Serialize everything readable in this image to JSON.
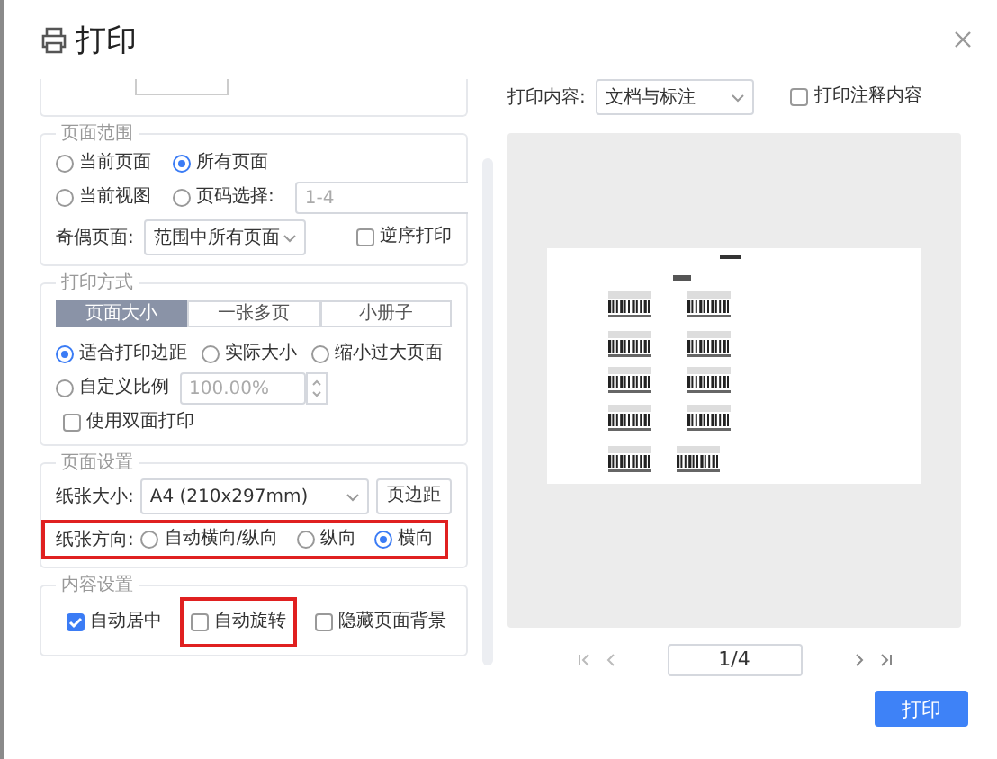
{
  "dialog": {
    "title": "打印"
  },
  "page_range": {
    "title": "页面范围",
    "options": [
      {
        "label": "当前页面",
        "selected": false
      },
      {
        "label": "所有页面",
        "selected": true
      },
      {
        "label": "当前视图",
        "selected": false
      },
      {
        "label": "页码选择:",
        "selected": false
      }
    ],
    "page_input": {
      "placeholder": "1-4"
    },
    "odd_even": {
      "label": "奇偶页面:",
      "value": "范围中所有页面"
    },
    "reverse": {
      "label": "逆序打印",
      "checked": false
    }
  },
  "print_mode": {
    "title": "打印方式",
    "tabs": [
      {
        "label": "页面大小",
        "selected": true
      },
      {
        "label": "一张多页",
        "selected": false
      },
      {
        "label": "小册子",
        "selected": false
      }
    ],
    "scale_options": [
      {
        "label": "适合打印边距",
        "selected": true
      },
      {
        "label": "实际大小",
        "selected": false
      },
      {
        "label": "缩小过大页面",
        "selected": false
      },
      {
        "label": "自定义比例",
        "selected": false
      }
    ],
    "scale_input": {
      "placeholder": "100.00%"
    },
    "duplex": {
      "label": "使用双面打印",
      "checked": false
    }
  },
  "page_setup": {
    "title": "页面设置",
    "paper_label": "纸张大小:",
    "paper_value": "A4 (210x297mm)",
    "margins_button": "页边距",
    "orientation_label": "纸张方向:",
    "orientation_highlighted": true,
    "orientation_options": [
      {
        "label": "自动横向/纵向",
        "selected": false
      },
      {
        "label": "纵向",
        "selected": false
      },
      {
        "label": "横向",
        "selected": true
      }
    ]
  },
  "content_settings": {
    "title": "内容设置",
    "options": [
      {
        "label": "自动居中",
        "checked": true,
        "highlighted": false
      },
      {
        "label": "自动旋转",
        "checked": false,
        "highlighted": true
      },
      {
        "label": "隐藏页面背景",
        "checked": false,
        "highlighted": false
      }
    ]
  },
  "print_content": {
    "label": "打印内容:",
    "value": "文档与标注"
  },
  "print_comments": {
    "label": "打印注释内容",
    "checked": false
  },
  "pagination": {
    "value": "1/4"
  },
  "print_button": "打印"
}
